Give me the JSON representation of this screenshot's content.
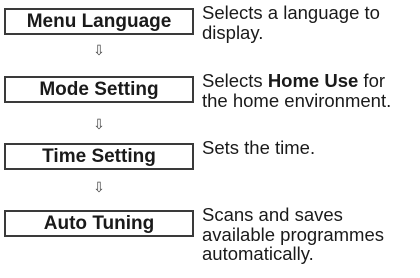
{
  "steps": [
    {
      "label": "Menu Language",
      "description_lines": [
        "Selects a language to",
        "display."
      ]
    },
    {
      "label": "Mode Setting",
      "description_before": "Selects ",
      "description_bold": "Home Use",
      "description_after": " for",
      "description_line2": "the home environment."
    },
    {
      "label": "Time Setting",
      "description_lines": [
        "Sets the time."
      ]
    },
    {
      "label": "Auto Tuning",
      "description_lines": [
        "Scans and saves",
        "available programmes",
        "automatically."
      ]
    }
  ],
  "arrow_glyph": "⇩"
}
